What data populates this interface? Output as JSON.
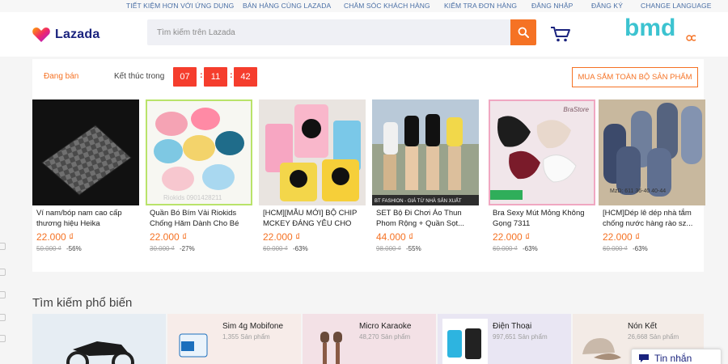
{
  "topbar": {
    "links": [
      "TIẾT KIỆM HƠN VỚI ỨNG DỤNG",
      "BÁN HÀNG CÙNG LAZADA",
      "CHĂM SÓC KHÁCH HÀNG",
      "KIỂM TRA ĐƠN HÀNG",
      "ĐĂNG NHẬP",
      "ĐĂNG KÝ",
      "CHANGE LANGUAGE"
    ]
  },
  "header": {
    "logo_text": "Lazada",
    "search_placeholder": "Tìm kiếm trên Lazada",
    "watermark": "bmd"
  },
  "flash_sale": {
    "on_sale_label": "Đang bán",
    "ends_in_label": "Kết thúc trong",
    "countdown": {
      "hours": "07",
      "minutes": "11",
      "seconds": "42"
    },
    "shop_all_label": "MUA SẮM TOÀN BỘ SẢN PHẨM",
    "products": [
      {
        "name": "Ví nam/bóp nam cao cấp thương hiệu Heika",
        "price": "22.000 ₫",
        "old_price": "50.000 ₫",
        "discount": "-56%"
      },
      {
        "name": "Quần Bó Bím Vải Riokids Chống Hăm Dành Cho Bé",
        "price": "22.000 ₫",
        "old_price": "30.000 ₫",
        "discount": "-27%",
        "image_text": "Riokids 0901428211"
      },
      {
        "name": "[HCM][MẪU MỚI] BỘ CHIP MCKEY ĐÁNG YÊU CHO B...",
        "price": "22.000 ₫",
        "old_price": "60.000 ₫",
        "discount": "-63%"
      },
      {
        "name": "SET Bộ Đi Chơi Áo Thun Phom Rộng + Quần Sọt...",
        "price": "44.000 ₫",
        "old_price": "98.000 ₫",
        "discount": "-55%",
        "image_text": "BT FASHION - GIÁ TỪ NHÀ SẢN XUẤT"
      },
      {
        "name": "Bra Sexy Mút Mỏng Không Gọng 7311",
        "price": "22.000 ₫",
        "old_price": "60.000 ₫",
        "discount": "-63%",
        "image_text": "BraStore"
      },
      {
        "name": "[HCM]Dép lê dép nhà tắm chống nước hàng rào sz...",
        "price": "22.000 ₫",
        "old_price": "60.000 ₫",
        "discount": "-63%",
        "image_text": "MzD: 611   36-40   40-44"
      }
    ]
  },
  "popular": {
    "title": "Tìm kiếm phổ biến",
    "categories": [
      {
        "name": "",
        "count": ""
      },
      {
        "name": "Sim 4g Mobifone",
        "count": "1,355 Sản phẩm"
      },
      {
        "name": "Micro Karaoke",
        "count": "48,270 Sản phẩm"
      },
      {
        "name": "Điện Thoại",
        "count": "997,651 Sản phẩm"
      },
      {
        "name": "Nón Kết",
        "count": "26,668 Sản phẩm"
      }
    ]
  },
  "chat": {
    "label": "Tin nhắn"
  },
  "colors": {
    "accent": "#f57224",
    "timer": "#f53d2d",
    "brand": "#1a237e"
  }
}
